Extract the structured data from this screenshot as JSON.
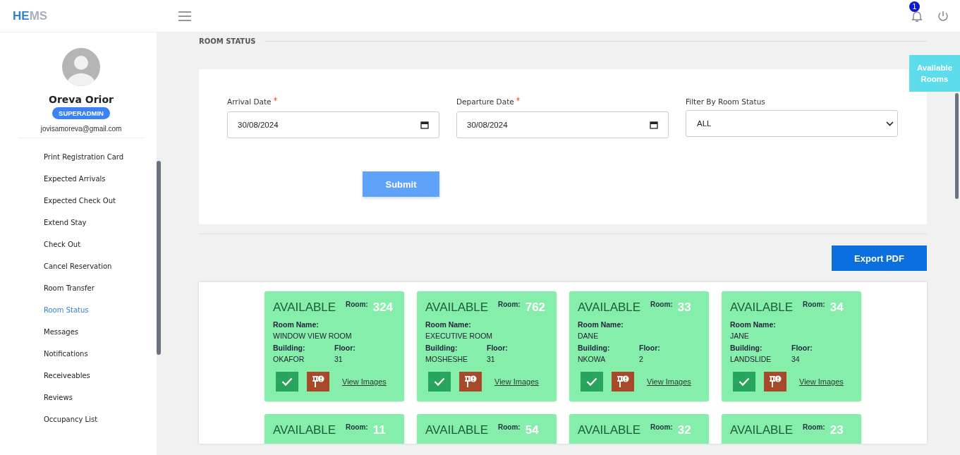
{
  "header": {
    "logo": [
      "HE",
      "MS"
    ],
    "notification_count": "1"
  },
  "sidebar": {
    "user": {
      "name": "Oreva Orior",
      "role": "SUPERADMIN",
      "email": "jovisamoreva@gmail.com"
    },
    "items": [
      {
        "label": "Print Registration Card",
        "selected": false
      },
      {
        "label": "Expected Arrivals",
        "selected": false
      },
      {
        "label": "Expected Check Out",
        "selected": false
      },
      {
        "label": "Extend Stay",
        "selected": false
      },
      {
        "label": "Check Out",
        "selected": false
      },
      {
        "label": "Cancel Reservation",
        "selected": false
      },
      {
        "label": "Room Transfer",
        "selected": false
      },
      {
        "label": "Room Status",
        "selected": true
      },
      {
        "label": "Messages",
        "selected": false
      },
      {
        "label": "Notifications",
        "selected": false
      },
      {
        "label": "Receiveables",
        "selected": false
      },
      {
        "label": "Reviews",
        "selected": false
      },
      {
        "label": "Occupancy List",
        "selected": false
      }
    ]
  },
  "page_title": "ROOM STATUS",
  "floating_tab": "Available Rooms",
  "filter": {
    "fields": [
      {
        "kind": "date",
        "label": "Arrival Date",
        "required": true,
        "value": "30/08/2024"
      },
      {
        "kind": "date",
        "label": "Departure Date",
        "required": true,
        "value": "30/08/2024"
      },
      {
        "kind": "select",
        "label": "Filter By Room Status",
        "required": false,
        "value": "ALL"
      }
    ],
    "submit": "Submit"
  },
  "export_button": "Export PDF",
  "rooms": [
    {
      "status": "AVAILABLE",
      "room_label": "Room:",
      "number": "324",
      "name_label": "Room Name:",
      "name": "WINDOW VIEW ROOM",
      "building_label": "Building:",
      "building": "OKAFOR",
      "floor_label": "Floor:",
      "floor": "31",
      "link": "View Images"
    },
    {
      "status": "AVAILABLE",
      "room_label": "Room:",
      "number": "762",
      "name_label": "Room Name:",
      "name": "EXECUTIVE ROOM",
      "building_label": "Building:",
      "building": "MOSHESHE",
      "floor_label": "Floor:",
      "floor": "31",
      "link": "View Images"
    },
    {
      "status": "AVAILABLE",
      "room_label": "Room:",
      "number": "33",
      "name_label": "Room Name:",
      "name": "DANE",
      "building_label": "Building:",
      "building": "NKOWA",
      "floor_label": "Floor:",
      "floor": "2",
      "link": "View Images"
    },
    {
      "status": "AVAILABLE",
      "room_label": "Room:",
      "number": "34",
      "name_label": "Room Name:",
      "name": "JANE",
      "building_label": "Building:",
      "building": "LANDSLIDE",
      "floor_label": "Floor:",
      "floor": "34",
      "link": "View Images"
    },
    {
      "status": "AVAILABLE",
      "room_label": "Room:",
      "number": "11"
    },
    {
      "status": "AVAILABLE",
      "room_label": "Room:",
      "number": "54"
    },
    {
      "status": "AVAILABLE",
      "room_label": "Room:",
      "number": "32"
    },
    {
      "status": "AVAILABLE",
      "room_label": "Room:",
      "number": "23"
    }
  ]
}
